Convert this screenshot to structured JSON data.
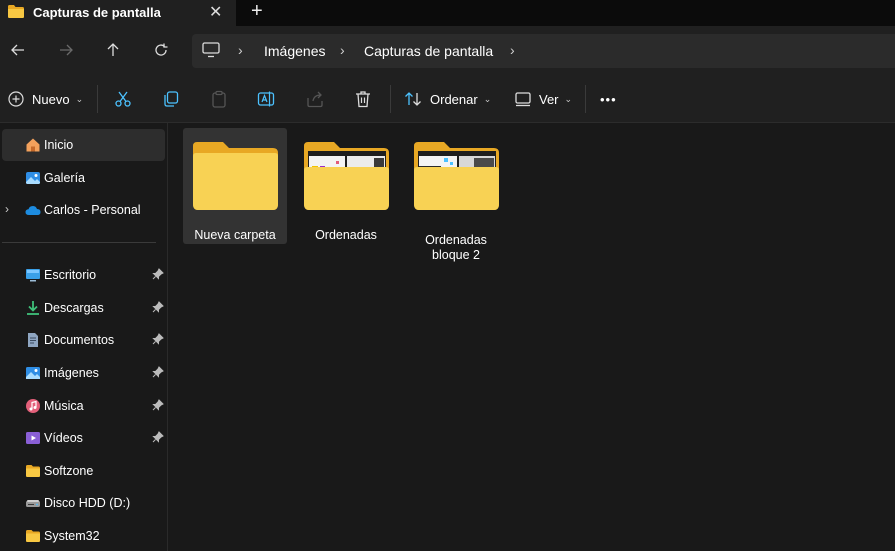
{
  "window": {
    "tab_title": "Capturas de pantalla",
    "tab_close": "✕",
    "new_tab": "+"
  },
  "navigation": {
    "back": "←",
    "forward": "→",
    "up": "↑",
    "refresh": "↻",
    "breadcrumb": [
      "Imágenes",
      "Capturas de pantalla"
    ],
    "breadcrumb_sep": "›"
  },
  "toolbar": {
    "new_label": "Nuevo",
    "sort_label": "Ordenar",
    "view_label": "Ver",
    "more": "•••",
    "chevron": "⌄"
  },
  "sidebar": {
    "top_items": [
      {
        "label": "Inicio",
        "icon": "home-icon"
      },
      {
        "label": "Galería",
        "icon": "gallery-icon"
      },
      {
        "label": "Carlos - Personal",
        "icon": "onedrive-icon"
      }
    ],
    "quick_access": [
      {
        "label": "Escritorio",
        "icon": "desktop-icon",
        "pinned": true
      },
      {
        "label": "Descargas",
        "icon": "downloads-icon",
        "pinned": true
      },
      {
        "label": "Documentos",
        "icon": "documents-icon",
        "pinned": true
      },
      {
        "label": "Imágenes",
        "icon": "pictures-icon",
        "pinned": true
      },
      {
        "label": "Música",
        "icon": "music-icon",
        "pinned": true
      },
      {
        "label": "Vídeos",
        "icon": "videos-icon",
        "pinned": true
      },
      {
        "label": "Softzone",
        "icon": "folder-icon",
        "pinned": false
      },
      {
        "label": "Disco HDD (D:)",
        "icon": "drive-icon",
        "pinned": false
      },
      {
        "label": "System32",
        "icon": "folder-icon",
        "pinned": false
      }
    ]
  },
  "content": {
    "folders": [
      {
        "name": "Nueva carpeta",
        "selected": true
      },
      {
        "name": "Ordenadas",
        "selected": false
      },
      {
        "name": "Ordenadas bloque 2",
        "selected": false
      }
    ]
  },
  "colors": {
    "background": "#191919",
    "folder_yellow": "#f8c843",
    "folder_back": "#e8a824",
    "accent_blue": "#4cc2ff"
  }
}
